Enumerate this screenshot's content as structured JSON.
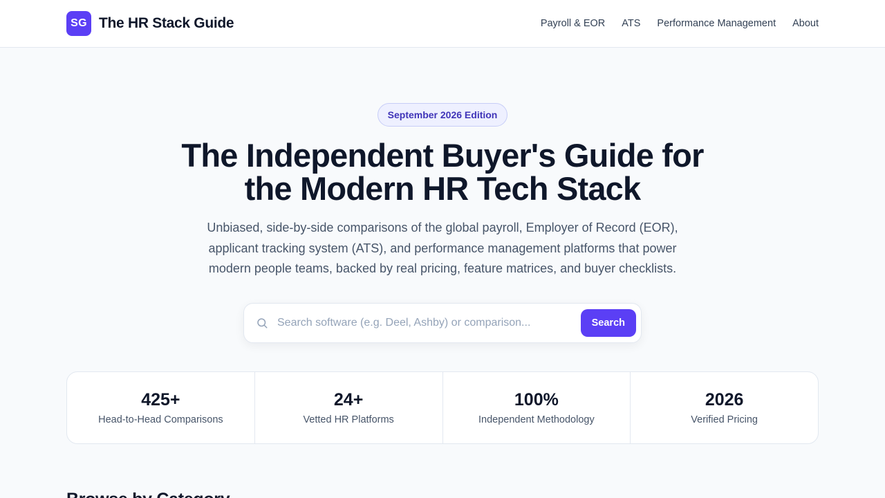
{
  "header": {
    "logo_initials": "SG",
    "brand_name": "The HR Stack Guide",
    "nav": [
      {
        "label": "Payroll & EOR"
      },
      {
        "label": "ATS"
      },
      {
        "label": "Performance Management"
      },
      {
        "label": "About"
      }
    ]
  },
  "hero": {
    "edition": "September 2026 Edition",
    "title": "The Independent Buyer's Guide for the Modern HR Tech Stack",
    "subtitle": "Unbiased, side-by-side comparisons of the global payroll, Employer of Record (EOR), applicant tracking system (ATS), and performance management platforms that power modern people teams, backed by real pricing, feature matrices, and buyer checklists."
  },
  "search": {
    "icon": "search-icon",
    "placeholder": "Search software (e.g. Deel, Ashby) or comparison...",
    "value": "",
    "button_label": "Search"
  },
  "stats": [
    {
      "value": "425+",
      "label": "Head-to-Head Comparisons"
    },
    {
      "value": "24+",
      "label": "Vetted HR Platforms"
    },
    {
      "value": "100%",
      "label": "Independent Methodology"
    },
    {
      "value": "2026",
      "label": "Verified Pricing"
    }
  ],
  "sections": {
    "browse_title": "Browse by Category"
  },
  "colors": {
    "accent": "#5b3ff5",
    "pill_text": "#3f34b8",
    "pill_bg": "#eef0ff",
    "heading": "#0f172a",
    "body_text": "#475569",
    "page_bg": "#f8fafc"
  }
}
